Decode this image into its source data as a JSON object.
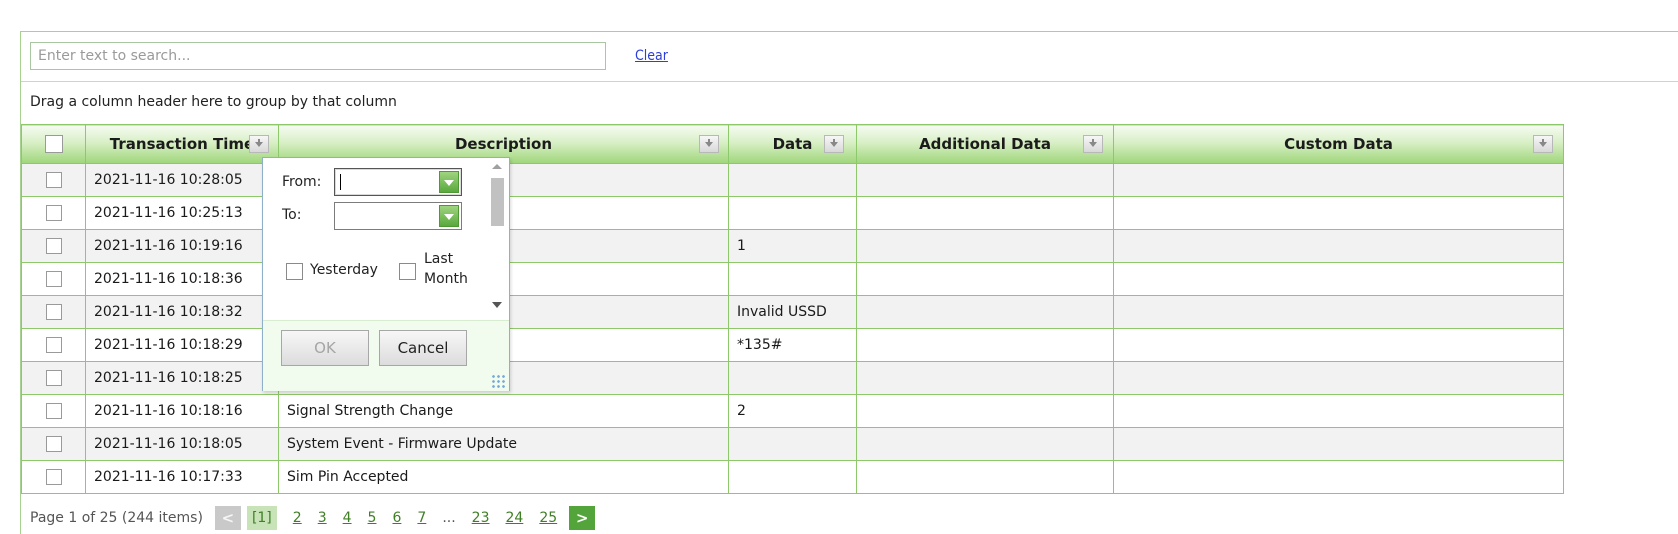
{
  "search": {
    "placeholder": "Enter text to search...",
    "value": "",
    "clear_label": "Clear"
  },
  "group_panel": {
    "text": "Drag a column header here to group by that column"
  },
  "columns": [
    {
      "label": "Transaction Time"
    },
    {
      "label": "Description"
    },
    {
      "label": "Data"
    },
    {
      "label": "Additional Data"
    },
    {
      "label": "Custom Data"
    }
  ],
  "rows": [
    {
      "time": "2021-11-16 10:28:05",
      "description": "",
      "data": "",
      "additional": "",
      "custom": ""
    },
    {
      "time": "2021-11-16 10:25:13",
      "description": "",
      "data": "",
      "additional": "",
      "custom": ""
    },
    {
      "time": "2021-11-16 10:19:16",
      "description": "",
      "data": "1",
      "additional": "",
      "custom": ""
    },
    {
      "time": "2021-11-16 10:18:36",
      "description": "",
      "data": "",
      "additional": "",
      "custom": ""
    },
    {
      "time": "2021-11-16 10:18:32",
      "description": "",
      "data": "Invalid USSD",
      "additional": "",
      "custom": ""
    },
    {
      "time": "2021-11-16 10:18:29",
      "description": "",
      "data": "*135#",
      "additional": "",
      "custom": ""
    },
    {
      "time": "2021-11-16 10:18:25",
      "description": "",
      "data": "",
      "additional": "",
      "custom": ""
    },
    {
      "time": "2021-11-16 10:18:16",
      "description": "Signal Strength Change",
      "data": "2",
      "additional": "",
      "custom": ""
    },
    {
      "time": "2021-11-16 10:18:05",
      "description": "System Event - Firmware Update",
      "data": "",
      "additional": "",
      "custom": ""
    },
    {
      "time": "2021-11-16 10:17:33",
      "description": "Sim Pin Accepted",
      "data": "",
      "additional": "",
      "custom": ""
    }
  ],
  "filter_popup": {
    "from_label": "From:",
    "to_label": "To:",
    "from_value": "",
    "to_value": "",
    "yesterday_label": "Yesterday",
    "last_month_label_line1": "Last",
    "last_month_label_line2": "Month",
    "ok_label": "OK",
    "cancel_label": "Cancel"
  },
  "pager": {
    "summary": "Page 1 of 25 (244 items)",
    "prev_label": "<",
    "next_label": ">",
    "current": "[1]",
    "pages": [
      "2",
      "3",
      "4",
      "5",
      "6",
      "7",
      "...",
      "23",
      "24",
      "25"
    ]
  },
  "colors": {
    "header_gradient_bottom": "#9fd67a",
    "grid_border": "#8dc86a",
    "pager_next": "#53a53b",
    "link": "#2d3fd6"
  },
  "icons": {
    "filter": "filter-dropdown-icon",
    "date_dropdown": "chevron-down-icon",
    "resize": "resize-grip-icon"
  }
}
